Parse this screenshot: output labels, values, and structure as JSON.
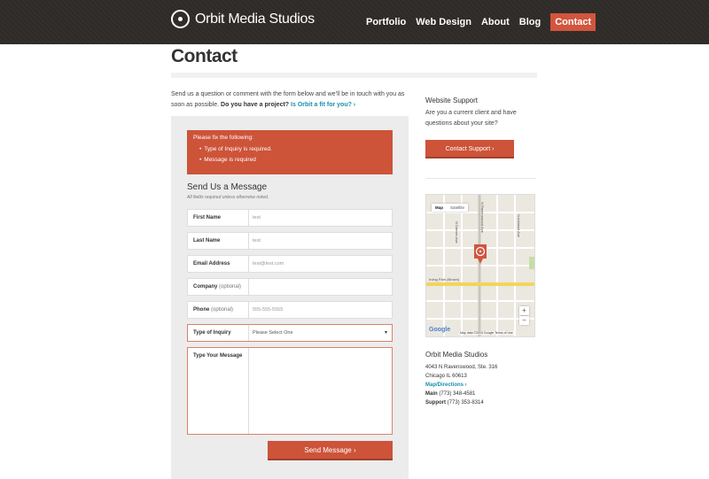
{
  "header": {
    "logo_text": "Orbit Media Studios",
    "nav": [
      "Portfolio",
      "Web Design",
      "About",
      "Blog",
      "Contact"
    ],
    "active_item": "Contact"
  },
  "page": {
    "title": "Contact",
    "intro_text": "Send us a question or comment with the form below and we’ll be in touch with you as soon as possible.",
    "intro_bold": "Do you have a project?",
    "intro_link": "Is Orbit a fit for you? ›"
  },
  "errors": {
    "title": "Please fix the following:",
    "items": [
      "Type of Inquiry is required.",
      "Message is required"
    ]
  },
  "form": {
    "title": "Send Us a Message",
    "subtitle": "All fields required unless otherwise noted.",
    "fields": [
      {
        "label": "First Name",
        "value": "test"
      },
      {
        "label": "Last Name",
        "value": "test"
      },
      {
        "label": "Email Address",
        "value": "test@test.com"
      },
      {
        "label": "Company",
        "optional": "(optional)",
        "value": ""
      },
      {
        "label": "Phone",
        "optional": "(optional)",
        "value": "555-555-5555"
      }
    ],
    "inquiry": {
      "label": "Type of Inquiry",
      "selected": "Please Select One"
    },
    "message_label": "Type Your Message",
    "submit": "Send Message ›"
  },
  "sidebar": {
    "support_title": "Website Support",
    "support_text": "Are you a current client and have questions about your site?",
    "support_button": "Contact Support ›",
    "map": {
      "tabs": [
        "Map",
        "Satellite"
      ],
      "zoom_in": "+",
      "zoom_out": "−",
      "google": "Google",
      "credit": "Map data ©2015 Google    Terms of Use",
      "streets": [
        "N Ravenswood Ave",
        "N Damen Ave",
        "N Ashland Ave",
        "Irving Park (Brown)"
      ]
    },
    "address_title": "Orbit Media Studios",
    "address_line1": "4043 N Ravenswood, Ste. 316",
    "address_line2": "Chicago IL 60613",
    "directions_link": "Map/Directions ›",
    "main_label": "Main",
    "main_phone": "(773) 348-4581",
    "support_label": "Support",
    "support_phone": "(773) 353-8314"
  },
  "colors": {
    "header_bg": "#2e2a28",
    "accent": "#cd5339",
    "link": "#1a8fb0"
  }
}
